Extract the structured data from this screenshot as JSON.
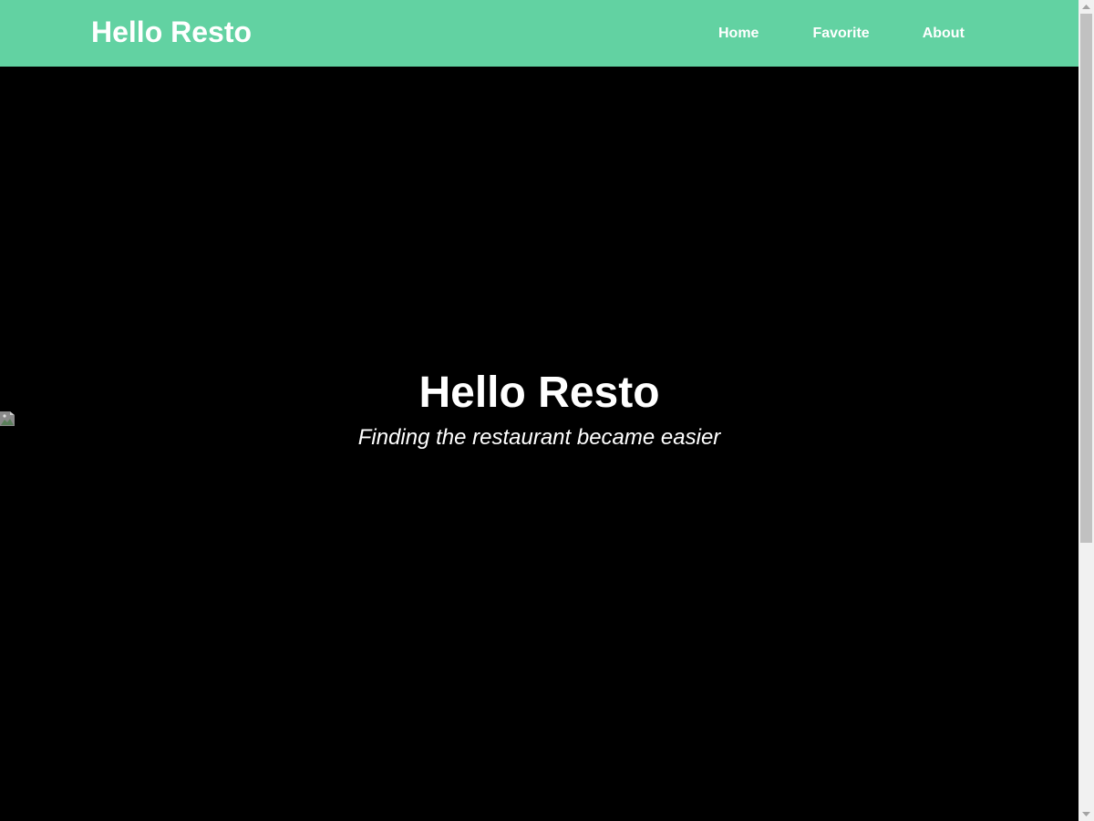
{
  "header": {
    "brand": "Hello Resto",
    "nav": {
      "home": "Home",
      "favorite": "Favorite",
      "about": "About"
    }
  },
  "hero": {
    "title": "Hello Resto",
    "tagline": "Finding the restaurant became easier",
    "image_icon": "broken-image-icon"
  },
  "colors": {
    "header_bg": "#62d2a2",
    "hero_bg": "#000000",
    "text": "#ffffff",
    "scrollbar_track": "#f1f1f1",
    "scrollbar_thumb": "#c1c1c1"
  },
  "icons": {
    "scroll_up": "scroll-up-arrow-icon",
    "scroll_down": "scroll-down-arrow-icon"
  }
}
